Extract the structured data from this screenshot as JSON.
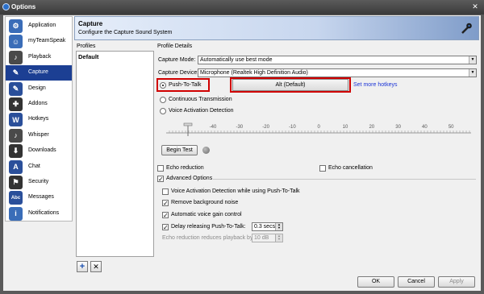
{
  "window": {
    "title": "Options",
    "close_glyph": "✕"
  },
  "sidebar": {
    "items": [
      {
        "label": "Application",
        "icon": "application-icon",
        "glyph": "⚙",
        "color": "#3a6db8"
      },
      {
        "label": "myTeamSpeak",
        "icon": "user-icon",
        "glyph": "☺",
        "color": "#3a6db8"
      },
      {
        "label": "Playback",
        "icon": "speaker-icon",
        "glyph": "♪",
        "color": "#4a4a4a"
      },
      {
        "label": "Capture",
        "icon": "microphone-icon",
        "glyph": "✎",
        "color": "#1c3f93"
      },
      {
        "label": "Design",
        "icon": "design-icon",
        "glyph": "✎",
        "color": "#2a4f9a"
      },
      {
        "label": "Addons",
        "icon": "puzzle-icon",
        "glyph": "✚",
        "color": "#333"
      },
      {
        "label": "Hotkeys",
        "icon": "hotkeys-icon",
        "glyph": "W",
        "color": "#2a4f9a"
      },
      {
        "label": "Whisper",
        "icon": "whisper-icon",
        "glyph": "♪",
        "color": "#4a4a4a"
      },
      {
        "label": "Downloads",
        "icon": "download-icon",
        "glyph": "⬇",
        "color": "#333"
      },
      {
        "label": "Chat",
        "icon": "chat-icon",
        "glyph": "A",
        "color": "#2a4f9a"
      },
      {
        "label": "Security",
        "icon": "security-icon",
        "glyph": "⚑",
        "color": "#333"
      },
      {
        "label": "Messages",
        "icon": "messages-icon",
        "glyph": "Abc",
        "color": "#2a4f9a"
      },
      {
        "label": "Notifications",
        "icon": "notifications-icon",
        "glyph": "i",
        "color": "#3a6db8"
      }
    ],
    "selected": "Capture"
  },
  "header": {
    "title": "Capture",
    "subtitle": "Configure the Capture Sound System"
  },
  "profiles": {
    "label": "Profiles",
    "items": [
      "Default"
    ],
    "add_glyph": "+",
    "remove_glyph": "✕"
  },
  "details": {
    "label": "Profile Details",
    "capture_mode": {
      "label": "Capture Mode:",
      "value": "Automatically use best mode"
    },
    "capture_device": {
      "label": "Capture Device:",
      "value": "Microphone (Realtek High Definition Audio)"
    },
    "push_to_talk": {
      "label": "Push-To-Talk",
      "checked": true
    },
    "hotkey": {
      "value": "Alt (Default)"
    },
    "more_hotkeys": "Set more hotkeys",
    "continuous": {
      "label": "Continuous Transmission",
      "checked": false
    },
    "voice_activation": {
      "label": "Voice Activation Detection",
      "checked": false
    },
    "scale_ticks": [
      "-40",
      "-30",
      "-20",
      "-10",
      "0",
      "10",
      "20",
      "30",
      "40",
      "50"
    ],
    "begin_test": "Begin Test",
    "echo_reduction": {
      "label": "Echo reduction",
      "checked": false
    },
    "echo_cancellation": {
      "label": "Echo cancellation",
      "checked": false
    },
    "advanced": {
      "label": "Advanced Options",
      "checked": true
    },
    "vad_while_ptt": {
      "label": "Voice Activation Detection while using Push-To-Talk",
      "checked": false
    },
    "remove_noise": {
      "label": "Remove background noise",
      "checked": true
    },
    "auto_gain": {
      "label": "Automatic voice gain control",
      "checked": true
    },
    "delay_release": {
      "label": "Delay releasing Push-To-Talk:",
      "checked": true,
      "value": "0.3 secs"
    },
    "echo_playback": {
      "label": "Echo reduction reduces playback by:",
      "value": "10 dB"
    }
  },
  "buttons": {
    "ok": "OK",
    "cancel": "Cancel",
    "apply": "Apply"
  },
  "colors": {
    "accent": "#1c3f93",
    "highlight_box": "#d00000",
    "link": "#1a33d6"
  }
}
